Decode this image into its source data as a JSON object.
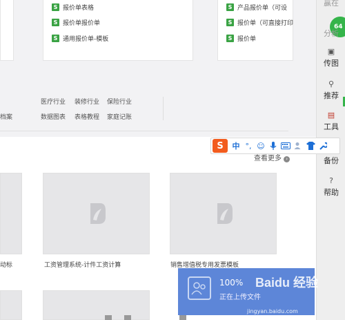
{
  "top_templates": {
    "middle": [
      "报价单表格",
      "报价单报价单",
      "通用报价单-模板"
    ],
    "right": [
      "产品报价单（可设",
      "报价单（可直接打印",
      "报价单"
    ]
  },
  "categories": {
    "row1": [
      "医疗行业",
      "装修行业",
      "保险行业"
    ],
    "row2": [
      "数据图表",
      "表格教程",
      "家庭记账"
    ],
    "left_cut": "档案"
  },
  "see_more": "查看更多",
  "templates": [
    {
      "caption": "动标"
    },
    {
      "caption": "工资管理系统-计件工资计算"
    },
    {
      "caption": "销售增值税专用发票模板"
    }
  ],
  "sidebar": {
    "badge": "64",
    "items": [
      {
        "label": "分析",
        "icon": "analysis-icon"
      },
      {
        "label": "传图",
        "icon": "image-upload-icon"
      },
      {
        "label": "推荐",
        "icon": "pin-icon"
      },
      {
        "label": "工具",
        "icon": "toolbox-icon"
      },
      {
        "label": "备份",
        "icon": "backup-icon"
      },
      {
        "label": "帮助",
        "icon": "help-icon"
      }
    ],
    "top_cut": "赢在"
  },
  "ime": {
    "logo": "S",
    "mode": "中",
    "punct": "°,"
  },
  "upload_toast": {
    "percent": "100%",
    "message": "正在上传文件"
  },
  "watermark": {
    "text": "Baidu 经验",
    "url": "jingyan.baidu.com"
  },
  "colors": {
    "sogou_orange": "#f25c1e",
    "toast_blue": "#5d86d8",
    "wps_green": "#3aa344",
    "badge_green": "#35b44a"
  }
}
